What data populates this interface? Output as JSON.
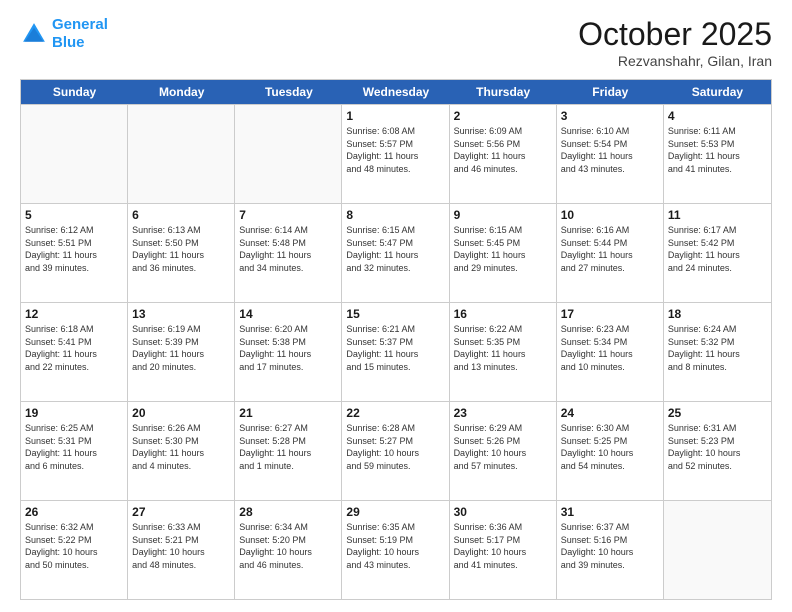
{
  "header": {
    "logo_line1": "General",
    "logo_line2": "Blue",
    "month": "October 2025",
    "location": "Rezvanshahr, Gilan, Iran"
  },
  "weekdays": [
    "Sunday",
    "Monday",
    "Tuesday",
    "Wednesday",
    "Thursday",
    "Friday",
    "Saturday"
  ],
  "rows": [
    [
      {
        "day": "",
        "info": ""
      },
      {
        "day": "",
        "info": ""
      },
      {
        "day": "",
        "info": ""
      },
      {
        "day": "1",
        "info": "Sunrise: 6:08 AM\nSunset: 5:57 PM\nDaylight: 11 hours\nand 48 minutes."
      },
      {
        "day": "2",
        "info": "Sunrise: 6:09 AM\nSunset: 5:56 PM\nDaylight: 11 hours\nand 46 minutes."
      },
      {
        "day": "3",
        "info": "Sunrise: 6:10 AM\nSunset: 5:54 PM\nDaylight: 11 hours\nand 43 minutes."
      },
      {
        "day": "4",
        "info": "Sunrise: 6:11 AM\nSunset: 5:53 PM\nDaylight: 11 hours\nand 41 minutes."
      }
    ],
    [
      {
        "day": "5",
        "info": "Sunrise: 6:12 AM\nSunset: 5:51 PM\nDaylight: 11 hours\nand 39 minutes."
      },
      {
        "day": "6",
        "info": "Sunrise: 6:13 AM\nSunset: 5:50 PM\nDaylight: 11 hours\nand 36 minutes."
      },
      {
        "day": "7",
        "info": "Sunrise: 6:14 AM\nSunset: 5:48 PM\nDaylight: 11 hours\nand 34 minutes."
      },
      {
        "day": "8",
        "info": "Sunrise: 6:15 AM\nSunset: 5:47 PM\nDaylight: 11 hours\nand 32 minutes."
      },
      {
        "day": "9",
        "info": "Sunrise: 6:15 AM\nSunset: 5:45 PM\nDaylight: 11 hours\nand 29 minutes."
      },
      {
        "day": "10",
        "info": "Sunrise: 6:16 AM\nSunset: 5:44 PM\nDaylight: 11 hours\nand 27 minutes."
      },
      {
        "day": "11",
        "info": "Sunrise: 6:17 AM\nSunset: 5:42 PM\nDaylight: 11 hours\nand 24 minutes."
      }
    ],
    [
      {
        "day": "12",
        "info": "Sunrise: 6:18 AM\nSunset: 5:41 PM\nDaylight: 11 hours\nand 22 minutes."
      },
      {
        "day": "13",
        "info": "Sunrise: 6:19 AM\nSunset: 5:39 PM\nDaylight: 11 hours\nand 20 minutes."
      },
      {
        "day": "14",
        "info": "Sunrise: 6:20 AM\nSunset: 5:38 PM\nDaylight: 11 hours\nand 17 minutes."
      },
      {
        "day": "15",
        "info": "Sunrise: 6:21 AM\nSunset: 5:37 PM\nDaylight: 11 hours\nand 15 minutes."
      },
      {
        "day": "16",
        "info": "Sunrise: 6:22 AM\nSunset: 5:35 PM\nDaylight: 11 hours\nand 13 minutes."
      },
      {
        "day": "17",
        "info": "Sunrise: 6:23 AM\nSunset: 5:34 PM\nDaylight: 11 hours\nand 10 minutes."
      },
      {
        "day": "18",
        "info": "Sunrise: 6:24 AM\nSunset: 5:32 PM\nDaylight: 11 hours\nand 8 minutes."
      }
    ],
    [
      {
        "day": "19",
        "info": "Sunrise: 6:25 AM\nSunset: 5:31 PM\nDaylight: 11 hours\nand 6 minutes."
      },
      {
        "day": "20",
        "info": "Sunrise: 6:26 AM\nSunset: 5:30 PM\nDaylight: 11 hours\nand 4 minutes."
      },
      {
        "day": "21",
        "info": "Sunrise: 6:27 AM\nSunset: 5:28 PM\nDaylight: 11 hours\nand 1 minute."
      },
      {
        "day": "22",
        "info": "Sunrise: 6:28 AM\nSunset: 5:27 PM\nDaylight: 10 hours\nand 59 minutes."
      },
      {
        "day": "23",
        "info": "Sunrise: 6:29 AM\nSunset: 5:26 PM\nDaylight: 10 hours\nand 57 minutes."
      },
      {
        "day": "24",
        "info": "Sunrise: 6:30 AM\nSunset: 5:25 PM\nDaylight: 10 hours\nand 54 minutes."
      },
      {
        "day": "25",
        "info": "Sunrise: 6:31 AM\nSunset: 5:23 PM\nDaylight: 10 hours\nand 52 minutes."
      }
    ],
    [
      {
        "day": "26",
        "info": "Sunrise: 6:32 AM\nSunset: 5:22 PM\nDaylight: 10 hours\nand 50 minutes."
      },
      {
        "day": "27",
        "info": "Sunrise: 6:33 AM\nSunset: 5:21 PM\nDaylight: 10 hours\nand 48 minutes."
      },
      {
        "day": "28",
        "info": "Sunrise: 6:34 AM\nSunset: 5:20 PM\nDaylight: 10 hours\nand 46 minutes."
      },
      {
        "day": "29",
        "info": "Sunrise: 6:35 AM\nSunset: 5:19 PM\nDaylight: 10 hours\nand 43 minutes."
      },
      {
        "day": "30",
        "info": "Sunrise: 6:36 AM\nSunset: 5:17 PM\nDaylight: 10 hours\nand 41 minutes."
      },
      {
        "day": "31",
        "info": "Sunrise: 6:37 AM\nSunset: 5:16 PM\nDaylight: 10 hours\nand 39 minutes."
      },
      {
        "day": "",
        "info": ""
      }
    ]
  ]
}
